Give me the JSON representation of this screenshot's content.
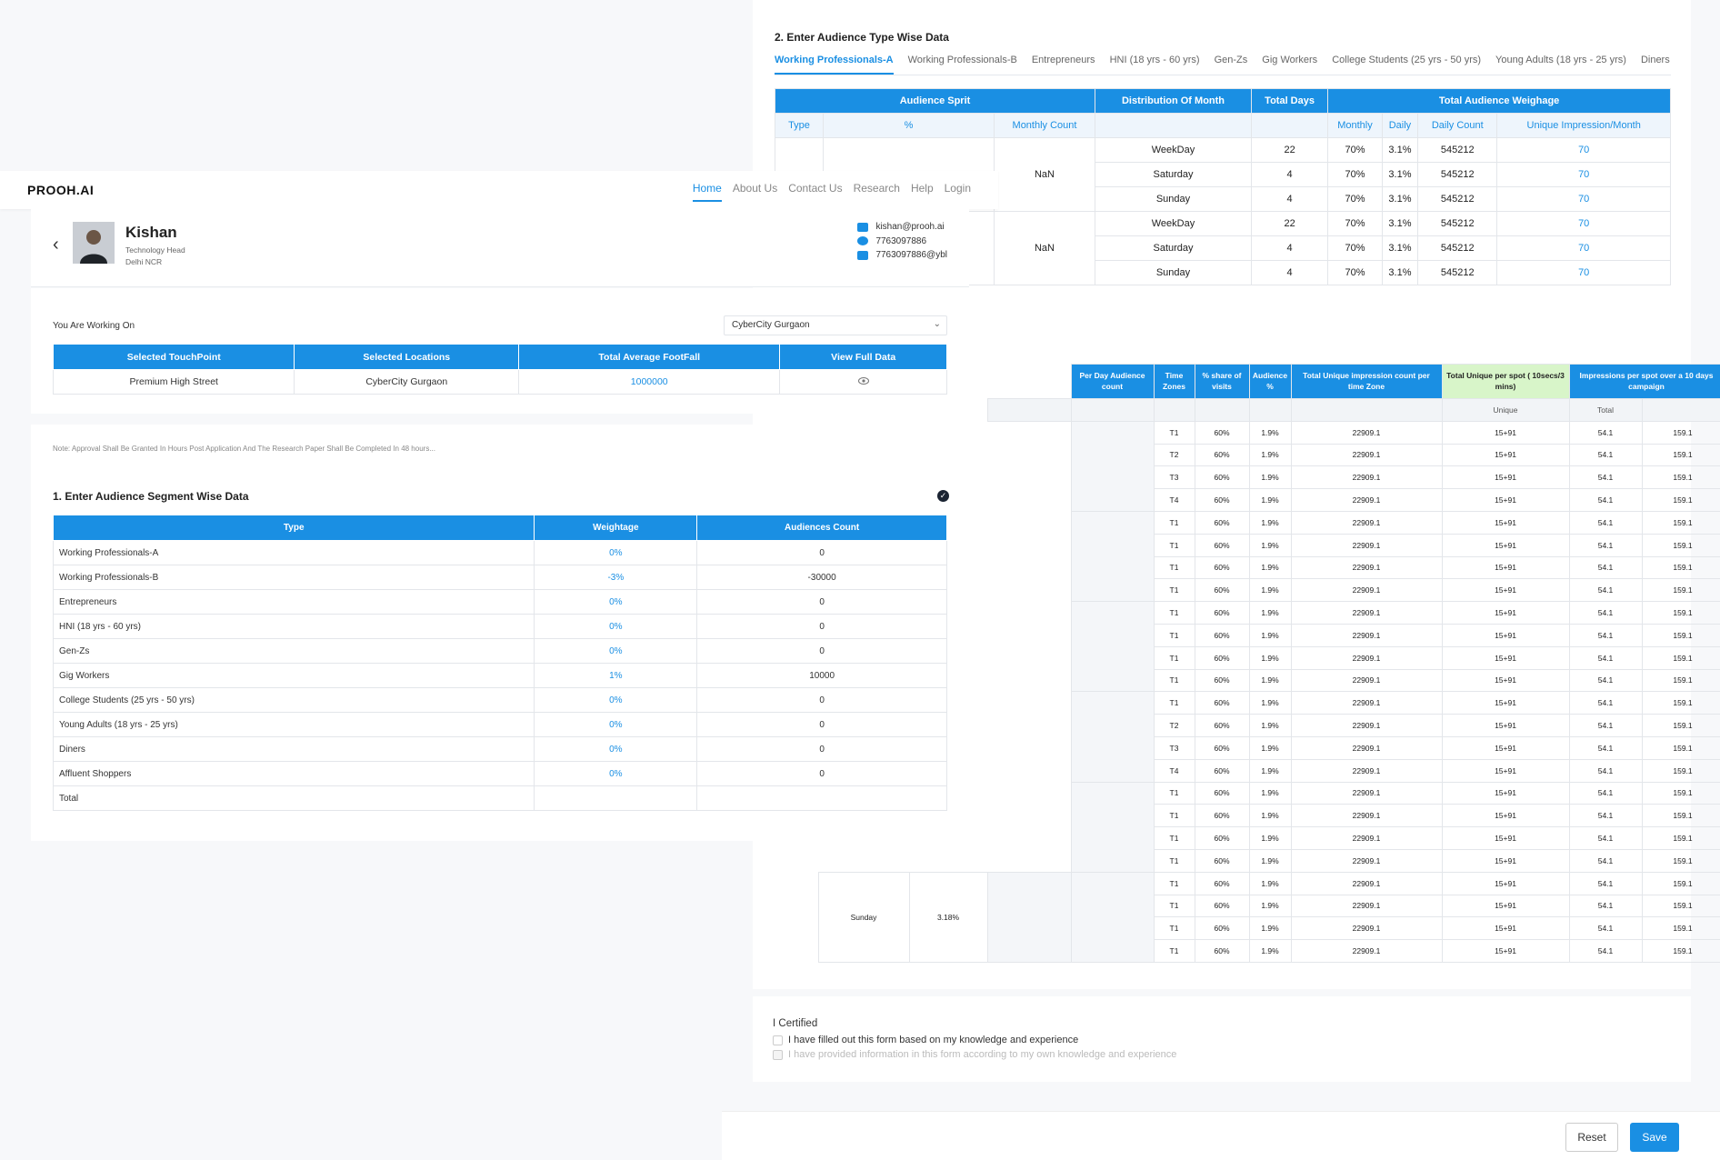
{
  "nav": {
    "logo": "PROOH.AI",
    "items": [
      "Home",
      "About Us",
      "Contact Us",
      "Research",
      "Help",
      "Login"
    ]
  },
  "profile": {
    "name": "Kishan",
    "role": "Technology Head",
    "location": "Delhi NCR",
    "email": "kishan@prooh.ai",
    "phone": "7763097886",
    "upi": "7763097886@ybl"
  },
  "working": {
    "label": "You Are Working On",
    "selected_location": "CyberCity Gurgaon",
    "headers": [
      "Selected TouchPoint",
      "Selected Locations",
      "Total Average FootFall",
      "View Full Data"
    ],
    "row": [
      "Premium High Street",
      "CyberCity Gurgaon",
      "1000000"
    ]
  },
  "note": "Note: Approval Shall Be Granted In Hours Post Application And The Research Paper Shall Be Completed In 48 hours...",
  "segment": {
    "title": "1. Enter Audience Segment Wise Data",
    "headers": [
      "Type",
      "Weightage",
      "Audiences Count"
    ],
    "rows": [
      [
        "Working Professionals-A",
        "0%",
        "0"
      ],
      [
        "Working Professionals-B",
        "-3%",
        "-30000"
      ],
      [
        "Entrepreneurs",
        "0%",
        "0"
      ],
      [
        "HNI (18 yrs - 60 yrs)",
        "0%",
        "0"
      ],
      [
        "Gen-Zs",
        "0%",
        "0"
      ],
      [
        "Gig Workers",
        "1%",
        "10000"
      ],
      [
        "College Students (25 yrs - 50 yrs)",
        "0%",
        "0"
      ],
      [
        "Young Adults (18 yrs - 25 yrs)",
        "0%",
        "0"
      ],
      [
        "Diners",
        "0%",
        "0"
      ],
      [
        "Affluent Shoppers",
        "0%",
        "0"
      ]
    ],
    "total_label": "Total"
  },
  "audience_type": {
    "title": "2. Enter Audience Type Wise Data",
    "tabs": [
      "Working Professionals-A",
      "Working Professionals-B",
      "Entrepreneurs",
      "HNI (18 yrs - 60 yrs)",
      "Gen-Zs",
      "Gig Workers",
      "College Students (25 yrs - 50 yrs)",
      "Young Adults (18 yrs - 25 yrs)",
      "Diners",
      "Affluent Shoppers"
    ],
    "group_headers": [
      "Audience Sprit",
      "Distribution Of Month",
      "Total Days",
      "Total Audience Weighage"
    ],
    "sub_headers": [
      "Type",
      "%",
      "Monthly Count",
      "",
      "",
      "Monthly",
      "Daily",
      "Daily Count",
      "Unique Impression/Month"
    ],
    "monthly_count": "NaN",
    "rows": [
      [
        "WeekDay",
        "22",
        "70%",
        "3.1%",
        "545212",
        "70"
      ],
      [
        "Saturday",
        "4",
        "70%",
        "3.1%",
        "545212",
        "70"
      ],
      [
        "Sunday",
        "4",
        "70%",
        "3.1%",
        "545212",
        "70"
      ],
      [
        "WeekDay",
        "22",
        "70%",
        "3.1%",
        "545212",
        "70"
      ],
      [
        "Saturday",
        "4",
        "70%",
        "3.1%",
        "545212",
        "70"
      ],
      [
        "Sunday",
        "4",
        "70%",
        "3.1%",
        "545212",
        "70"
      ]
    ]
  },
  "time_zone": {
    "headers": [
      "Per Day Audience count",
      "Time Zones",
      "% share of visits",
      "Audience %",
      "Total Unique impression count per time Zone",
      "Total Unique per spot ( 10secs/3 mins)",
      "Impressions per spot over a 10 days campaign"
    ],
    "sub_unique": "Unique",
    "sub_total": "Total",
    "day_label": "Sunday",
    "day_pct": "3.18%",
    "zones": [
      "T1",
      "T2",
      "T3",
      "T4",
      "T1",
      "T1",
      "T1",
      "T1",
      "T1",
      "T1",
      "T1",
      "T1",
      "T1",
      "T2",
      "T3",
      "T4",
      "T1",
      "T1",
      "T1",
      "T1",
      "T1",
      "T1",
      "T1",
      "T1"
    ],
    "share": "60%",
    "audience_pct": "1.9%",
    "impression": "22909.1",
    "unique": "15+91",
    "total_a": "54.1",
    "total_b": "159.1"
  },
  "certify": {
    "title": "I Certified",
    "item1": "I have filled out this form based on my knowledge and experience",
    "item2": "I have provided information in this form according to my own knowledge and experience"
  },
  "buttons": {
    "reset": "Reset",
    "save": "Save"
  }
}
